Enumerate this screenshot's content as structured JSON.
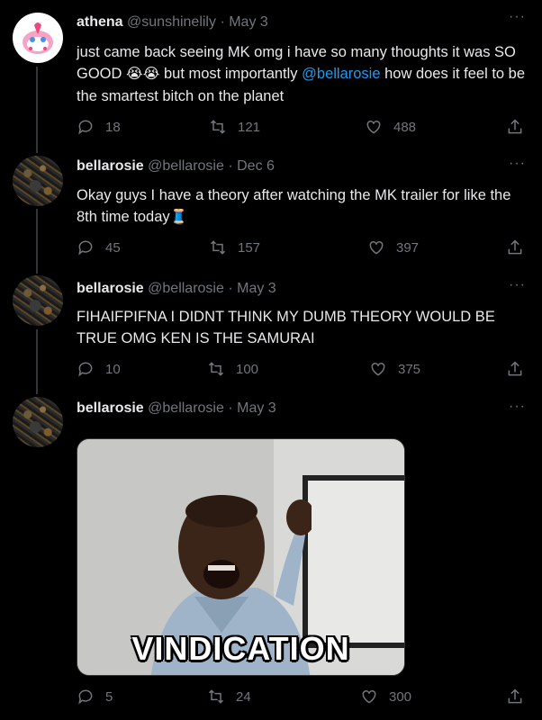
{
  "tweets": [
    {
      "name": "athena",
      "handle": "@sunshinelily",
      "date": "· May 3",
      "text_before": "just came back seeing MK omg i have so many thoughts it was SO GOOD ",
      "emoji": "😭😭",
      "text_middle": " but most importantly ",
      "mention": "@bellarosie",
      "text_after": " how does it feel to be the smartest bitch on the planet",
      "replies": "18",
      "retweets": "121",
      "likes": "488"
    },
    {
      "name": "bellarosie",
      "handle": "@bellarosie",
      "date": "· Dec 6",
      "text": "Okay guys I have a theory after watching the MK trailer for like the 8th time today",
      "emoji": "🧵",
      "replies": "45",
      "retweets": "157",
      "likes": "397"
    },
    {
      "name": "bellarosie",
      "handle": "@bellarosie",
      "date": "· May 3",
      "text": "FIHAIFPIFNA I DIDNT THINK MY DUMB THEORY WOULD BE TRUE OMG KEN IS THE SAMURAI",
      "replies": "10",
      "retweets": "100",
      "likes": "375"
    },
    {
      "name": "bellarosie",
      "handle": "@bellarosie",
      "date": "· May 3",
      "media_caption": "VINDICATION",
      "replies": "5",
      "retweets": "24",
      "likes": "300"
    }
  ],
  "more_label": "···",
  "icons": [
    "reply-icon",
    "retweet-icon",
    "like-icon",
    "share-icon",
    "more-icon"
  ]
}
